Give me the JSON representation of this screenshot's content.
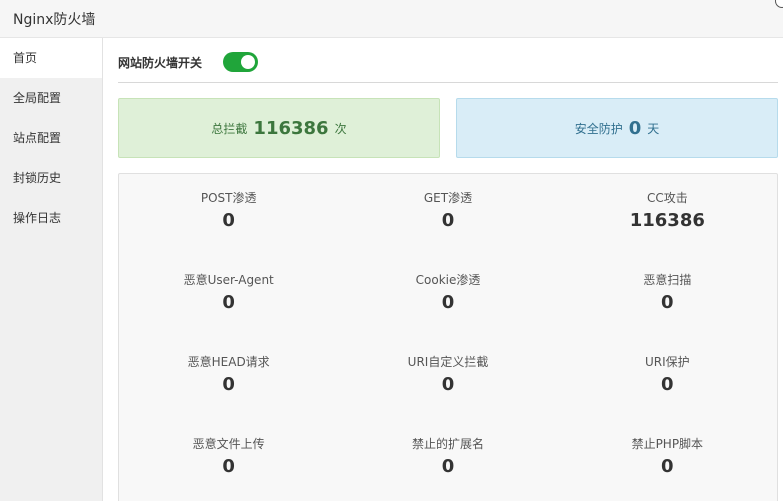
{
  "window": {
    "title": "Nginx防火墙"
  },
  "sidebar": {
    "items": [
      {
        "label": "首页"
      },
      {
        "label": "全局配置"
      },
      {
        "label": "站点配置"
      },
      {
        "label": "封锁历史"
      },
      {
        "label": "操作日志"
      }
    ]
  },
  "switch": {
    "label": "网站防火墙开关",
    "enabled": true
  },
  "summary": {
    "total": {
      "prefix": "总拦截",
      "value": "116386",
      "unit": "次",
      "color": "#3c763d"
    },
    "safe": {
      "prefix": "安全防护",
      "value": "0",
      "unit": "天",
      "color": "#31708f"
    }
  },
  "stats": [
    {
      "name": "POST渗透",
      "value": "0"
    },
    {
      "name": "GET渗透",
      "value": "0"
    },
    {
      "name": "CC攻击",
      "value": "116386"
    },
    {
      "name": "恶意User-Agent",
      "value": "0"
    },
    {
      "name": "Cookie渗透",
      "value": "0"
    },
    {
      "name": "恶意扫描",
      "value": "0"
    },
    {
      "name": "恶意HEAD请求",
      "value": "0"
    },
    {
      "name": "URI自定义拦截",
      "value": "0"
    },
    {
      "name": "URI保护",
      "value": "0"
    },
    {
      "name": "恶意文件上传",
      "value": "0"
    },
    {
      "name": "禁止的扩展名",
      "value": "0"
    },
    {
      "name": "禁止PHP脚本",
      "value": "0"
    }
  ],
  "colors": {
    "accent": "#20a53a"
  }
}
